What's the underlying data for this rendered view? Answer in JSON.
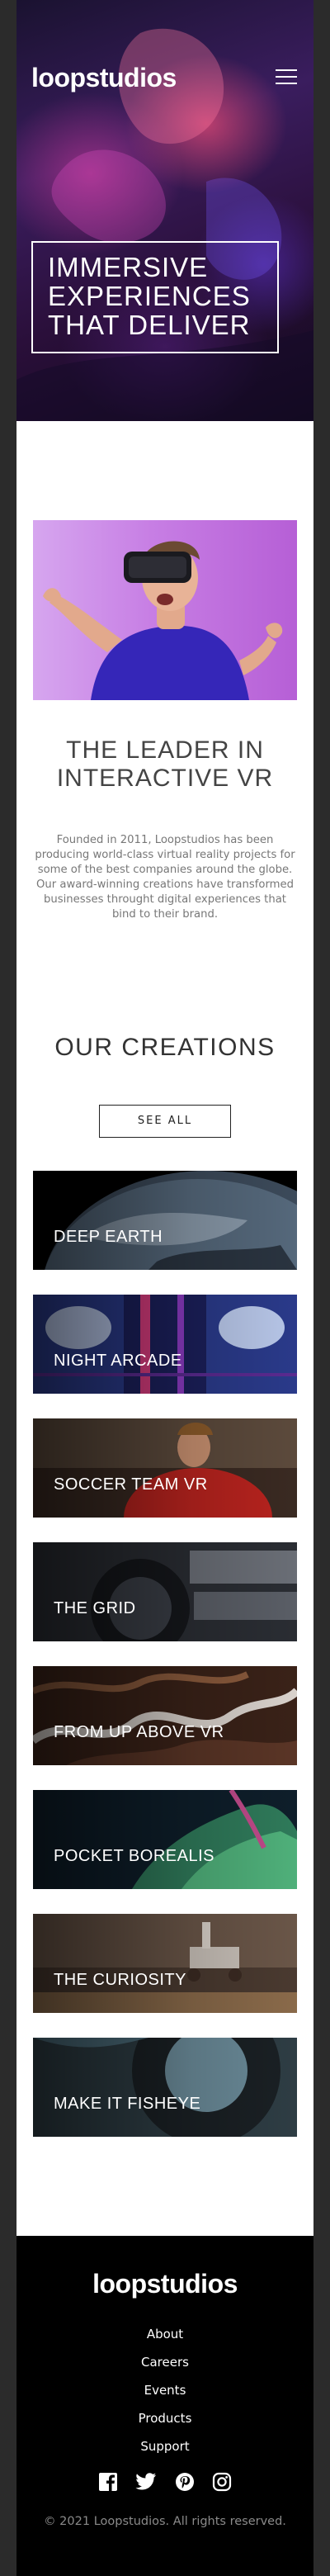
{
  "header": {
    "logo": "loopstudios",
    "menu_icon": "hamburger-icon"
  },
  "hero": {
    "headline_lines": [
      "IMMERSIVE",
      "EXPERIENCES",
      "THAT DELIVER"
    ]
  },
  "about": {
    "image_alt": "man-with-vr-headset",
    "title_lines": [
      "THE LEADER IN",
      "INTERACTIVE VR"
    ],
    "body": "Founded in 2011, Loopstudios has been producing world-class virtual reality projects for some of the best companies around the globe. Our award-winning creations have transformed businesses throught digital experiences that bind to their brand."
  },
  "creations": {
    "title": "OUR CREATIONS",
    "see_all_label": "SEE ALL",
    "items": [
      {
        "label": "DEEP EARTH"
      },
      {
        "label": "NIGHT ARCADE"
      },
      {
        "label": "SOCCER TEAM VR"
      },
      {
        "label": "THE GRID"
      },
      {
        "label": "FROM UP ABOVE VR"
      },
      {
        "label": "POCKET BOREALIS"
      },
      {
        "label": "THE CURIOSITY"
      },
      {
        "label": "MAKE IT FISHEYE"
      }
    ]
  },
  "footer": {
    "logo": "loopstudios",
    "links": [
      "About",
      "Careers",
      "Events",
      "Products",
      "Support"
    ],
    "socials": [
      "facebook-icon",
      "twitter-icon",
      "pinterest-icon",
      "instagram-icon"
    ],
    "copyright": "© 2021 Loopstudios. All rights reserved."
  },
  "colors": {
    "frame_bg": "#2b2b2b",
    "page_bg": "#ffffff",
    "footer_bg": "#000000",
    "text_dark": "#333333",
    "text_muted": "#777777"
  }
}
